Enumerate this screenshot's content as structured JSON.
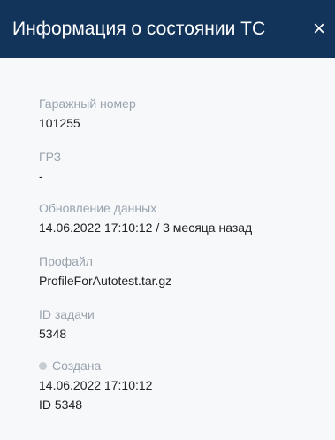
{
  "header": {
    "title": "Информация о состоянии ТС",
    "close_glyph": "×"
  },
  "fields": {
    "garage_number": {
      "label": "Гаражный номер",
      "value": "101255"
    },
    "grz": {
      "label": "ГРЗ",
      "value": "-"
    },
    "data_update": {
      "label": "Обновление данных",
      "value": "14.06.2022 17:10:12  / 3 месяца назад"
    },
    "profile": {
      "label": "Профайл",
      "value": "ProfileForAutotest.tar.gz"
    },
    "task_id": {
      "label": "ID задачи",
      "value": "5348"
    }
  },
  "status": {
    "label": "Создана",
    "date": "14.06.2022 17:10:12",
    "id": "ID 5348",
    "dot_color": "#c8cdd2"
  },
  "colors": {
    "header_bg": "#12345a",
    "panel_bg": "#f6f8fa",
    "label": "#9aa3ad",
    "value": "#222222"
  }
}
